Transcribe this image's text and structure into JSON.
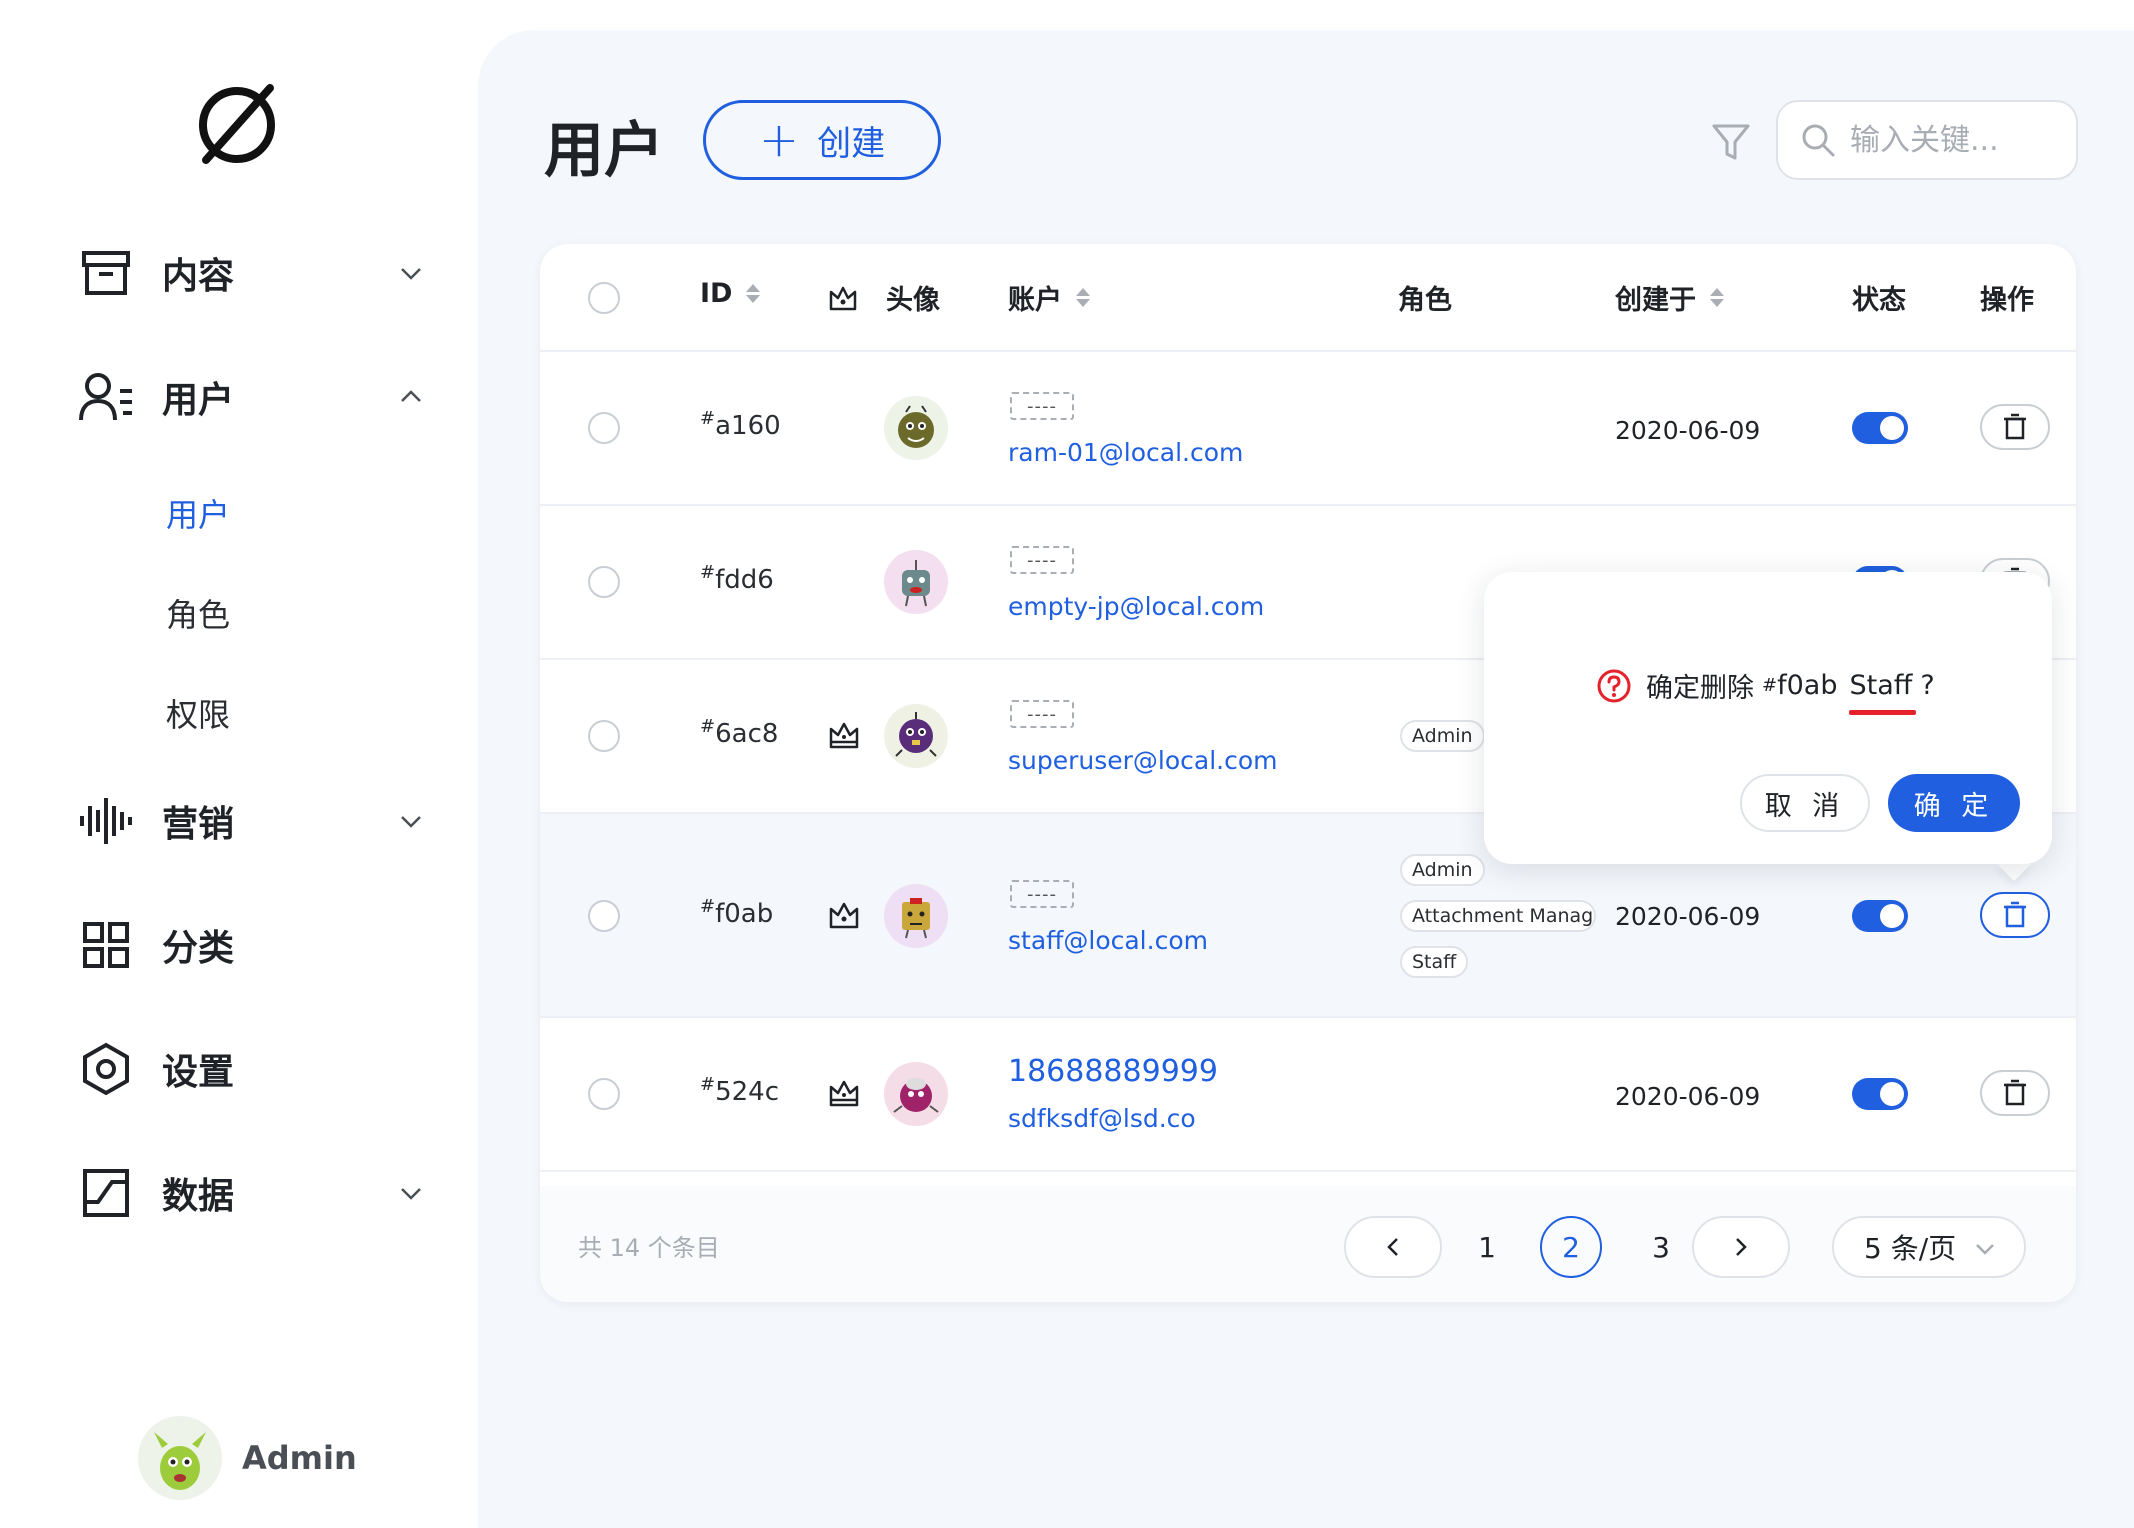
{
  "lang_tag": "CN",
  "sidebar": {
    "items": [
      {
        "label": "内容",
        "icon": "archive-icon"
      },
      {
        "label": "用户",
        "icon": "users-icon"
      },
      {
        "label": "营销",
        "icon": "audio-wave-icon"
      },
      {
        "label": "分类",
        "icon": "grid-icon"
      },
      {
        "label": "设置",
        "icon": "settings-hex-icon"
      },
      {
        "label": "数据",
        "icon": "data-icon"
      }
    ],
    "sub_items": [
      "用户",
      "角色",
      "权限"
    ],
    "active_sub": "用户",
    "user": {
      "name": "Admin"
    }
  },
  "header": {
    "title": "用户",
    "create_label": "创建",
    "search_placeholder": "输入关键..."
  },
  "table": {
    "columns": {
      "id": "ID",
      "avatar": "头像",
      "account": "账户",
      "roles": "角色",
      "created": "创建于",
      "status": "状态",
      "actions": "操作"
    },
    "rows": [
      {
        "hash": "#",
        "id": "a160",
        "nickname": "----",
        "email": "ram-01@local.com",
        "roles": [],
        "created": "2020-06-09",
        "status": true,
        "crown": "none"
      },
      {
        "hash": "#",
        "id": "fdd6",
        "nickname": "----",
        "email": "empty-jp@local.com",
        "roles": [],
        "created": "",
        "status": true,
        "crown": "none"
      },
      {
        "hash": "#",
        "id": "6ac8",
        "nickname": "----",
        "email": "superuser@local.com",
        "roles": [
          "Admin"
        ],
        "created": "",
        "status": true,
        "crown": "crown"
      },
      {
        "hash": "#",
        "id": "f0ab",
        "nickname": "----",
        "email": "staff@local.com",
        "roles": [
          "Admin",
          "Attachment Manag",
          "Staff"
        ],
        "created": "2020-06-09",
        "status": true,
        "crown": "crown-outline"
      },
      {
        "hash": "#",
        "id": "524c",
        "nickname": "18688889999",
        "email": "sdfksdf@lsd.co",
        "roles": [],
        "created": "2020-06-09",
        "status": true,
        "crown": "crown"
      }
    ]
  },
  "pagination": {
    "total_label": "共 14 个条目",
    "pages": [
      "1",
      "2",
      "3"
    ],
    "current": "2",
    "page_size_label": "5 条/页"
  },
  "popconfirm": {
    "prefix": "确定删除",
    "hash": "#",
    "target_id": "f0ab",
    "target_name": "Staff",
    "suffix": "?",
    "cancel_label": "取 消",
    "ok_label": "确 定"
  },
  "colors": {
    "accent": "#1f5fe0",
    "danger": "#e5212b"
  }
}
